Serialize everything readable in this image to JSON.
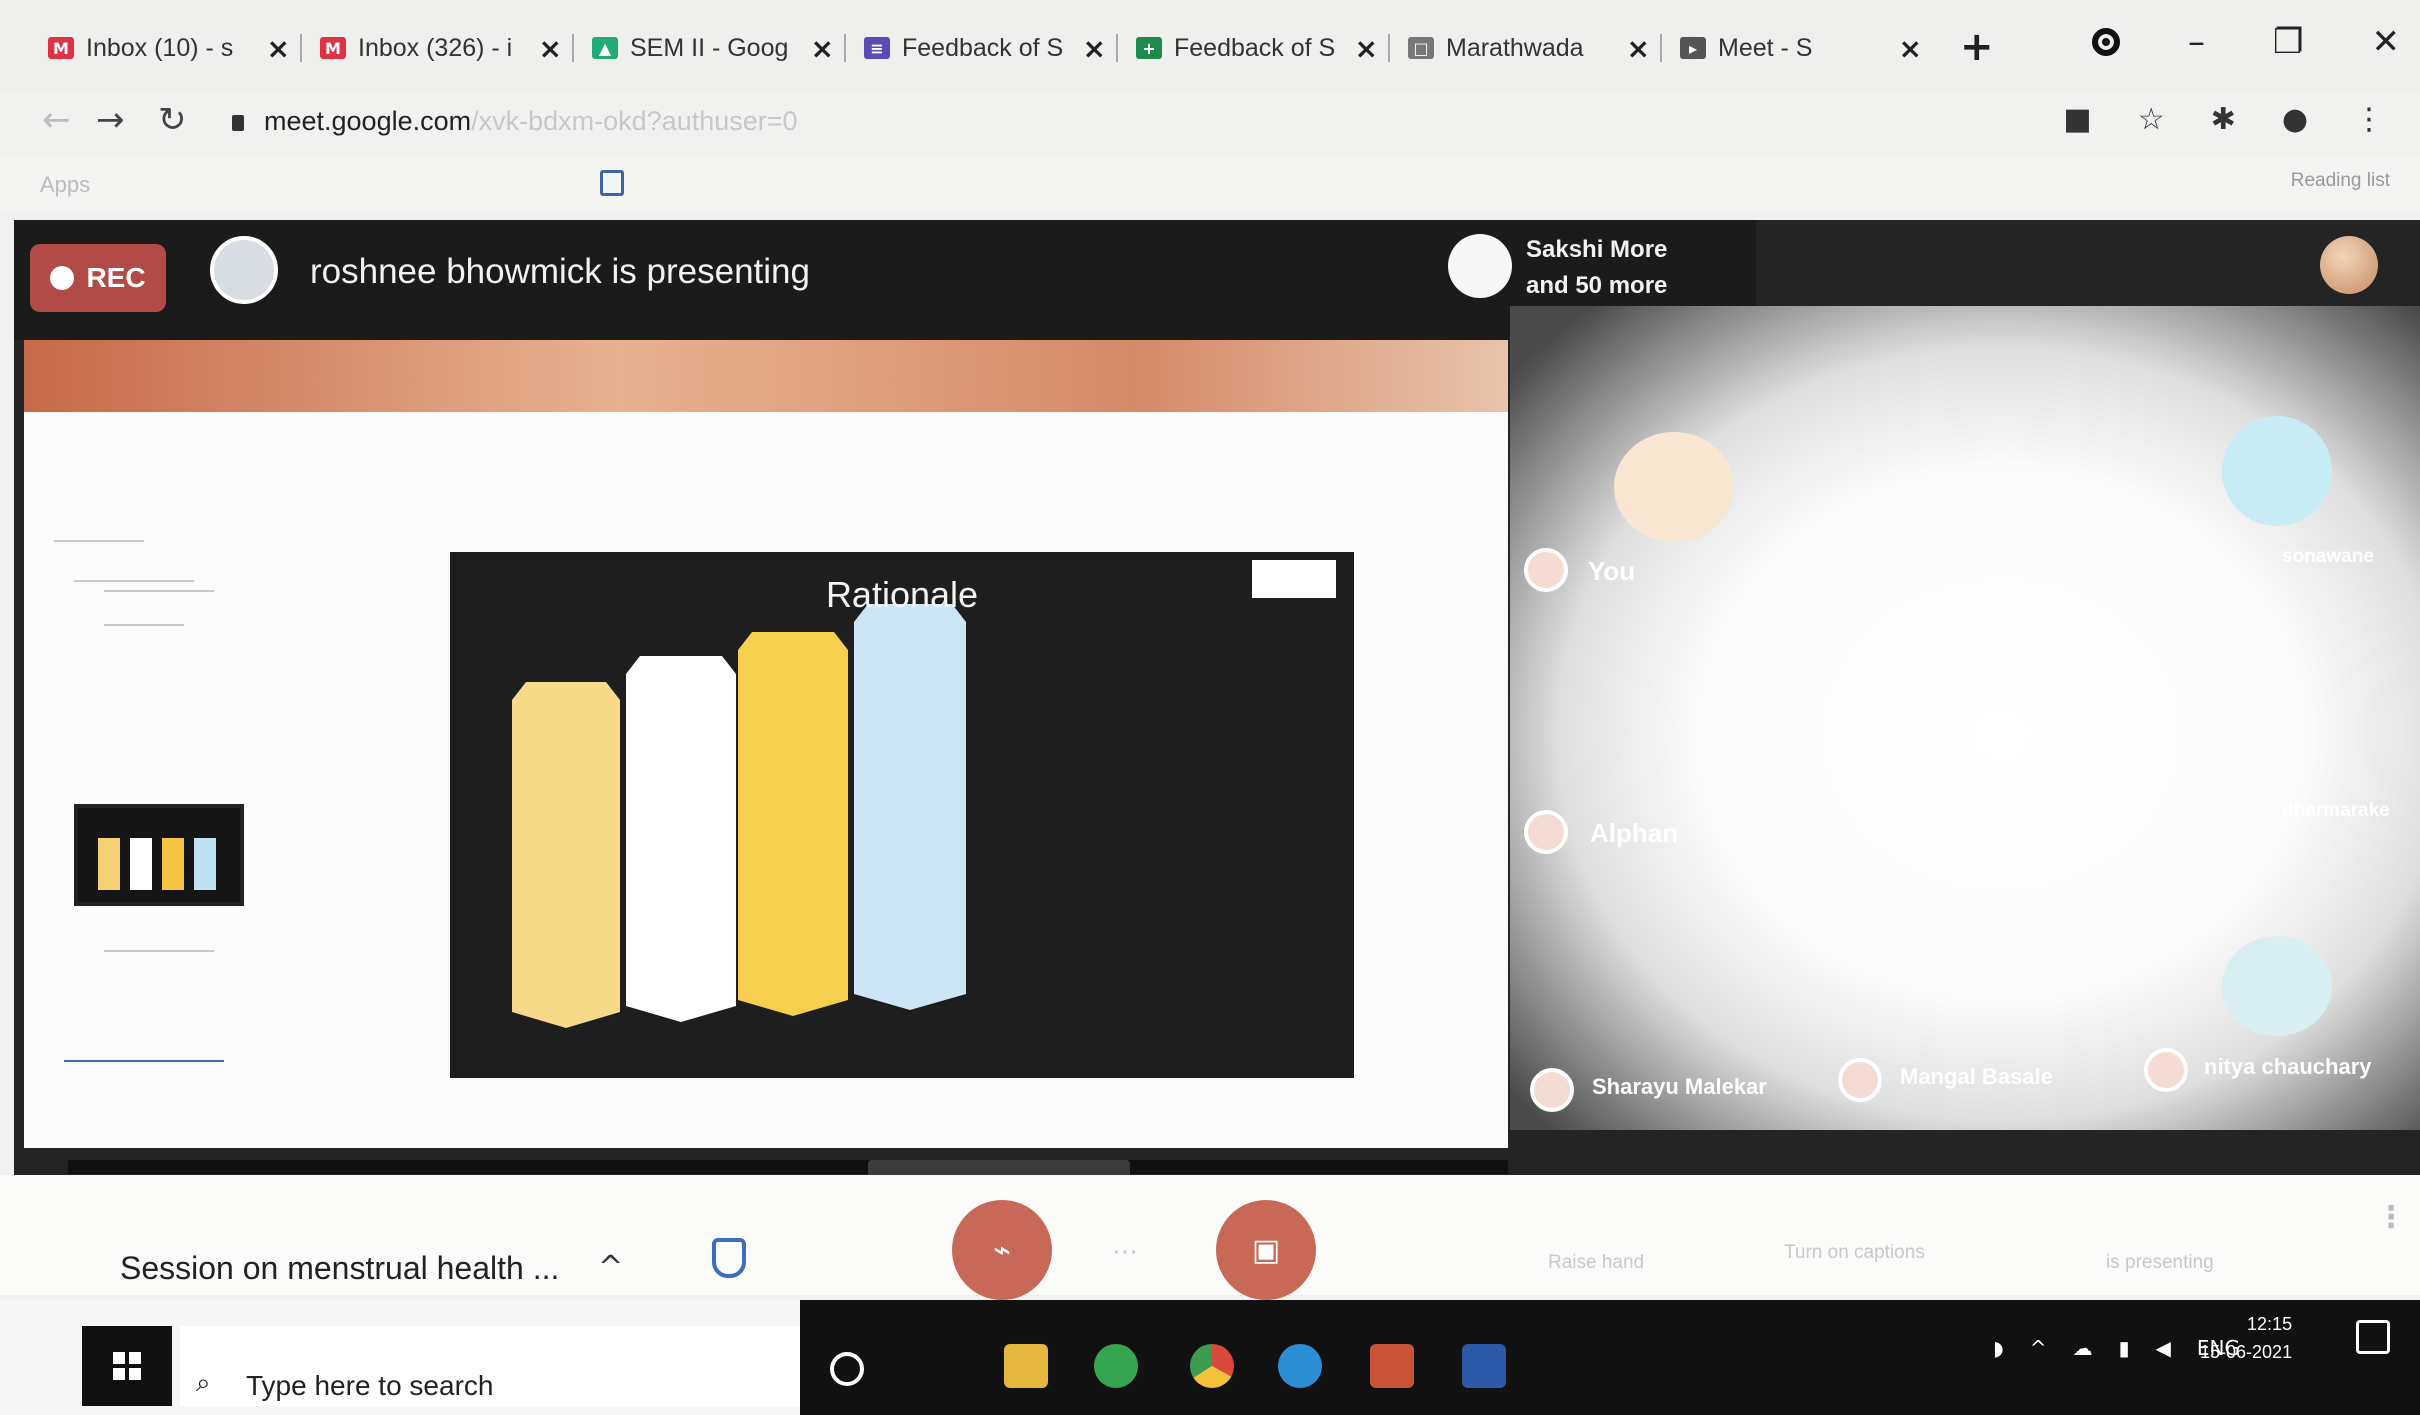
{
  "browser": {
    "tabs": [
      {
        "title": "Inbox (10) - s",
        "icon_color": "#d34",
        "icon": "M"
      },
      {
        "title": "Inbox (326) - i",
        "icon_color": "#d34",
        "icon": "M"
      },
      {
        "title": "SEM II - Goog",
        "icon_color": "#2a7",
        "icon": "▲"
      },
      {
        "title": "Feedback of S",
        "icon_color": "#5c4bb4",
        "icon": "≡"
      },
      {
        "title": "Feedback of S",
        "icon_color": "#1e8a4c",
        "icon": "+"
      },
      {
        "title": "Marathwada",
        "icon_color": "#777",
        "icon": "□"
      },
      {
        "title": "Meet - S",
        "icon_color": "#555",
        "icon": "▸"
      }
    ],
    "tab_close_glyph": "×",
    "new_tab_glyph": "+",
    "url_host": "meet.google.com",
    "url_path": "/xvk-bdxm-okd?authuser=0",
    "bookmarks_label": "Apps",
    "reading_list": "Reading list",
    "nav": {
      "back": "←",
      "forward": "→",
      "reload": "↻"
    }
  },
  "meet": {
    "rec_label": "REC",
    "presenter_text": "roshnee bhowmick is presenting",
    "others_line1": "Sakshi More",
    "others_line2": "and 50 more",
    "slide": {
      "title": "Rationale",
      "bar_colors": [
        "#f8d98a",
        "#ffffff",
        "#f6cf4f",
        "#cde6f5"
      ]
    },
    "participants": [
      {
        "name": "You"
      },
      {
        "name": "Alphan"
      },
      {
        "name": "Sharayu Malekar"
      },
      {
        "name": "Mangal Basale"
      },
      {
        "name": "nitya chauchary"
      },
      {
        "name": "sonawane"
      },
      {
        "name": "dharmarake"
      }
    ],
    "meeting_name": "Session on menstrual health ...",
    "controls": {
      "raise_hand": "Raise hand",
      "captions": "Turn on captions",
      "presenting": "is presenting"
    }
  },
  "taskbar": {
    "search_placeholder": "Type here to search",
    "language": "ENG",
    "time": "12:15",
    "date": "15-06-2021"
  }
}
